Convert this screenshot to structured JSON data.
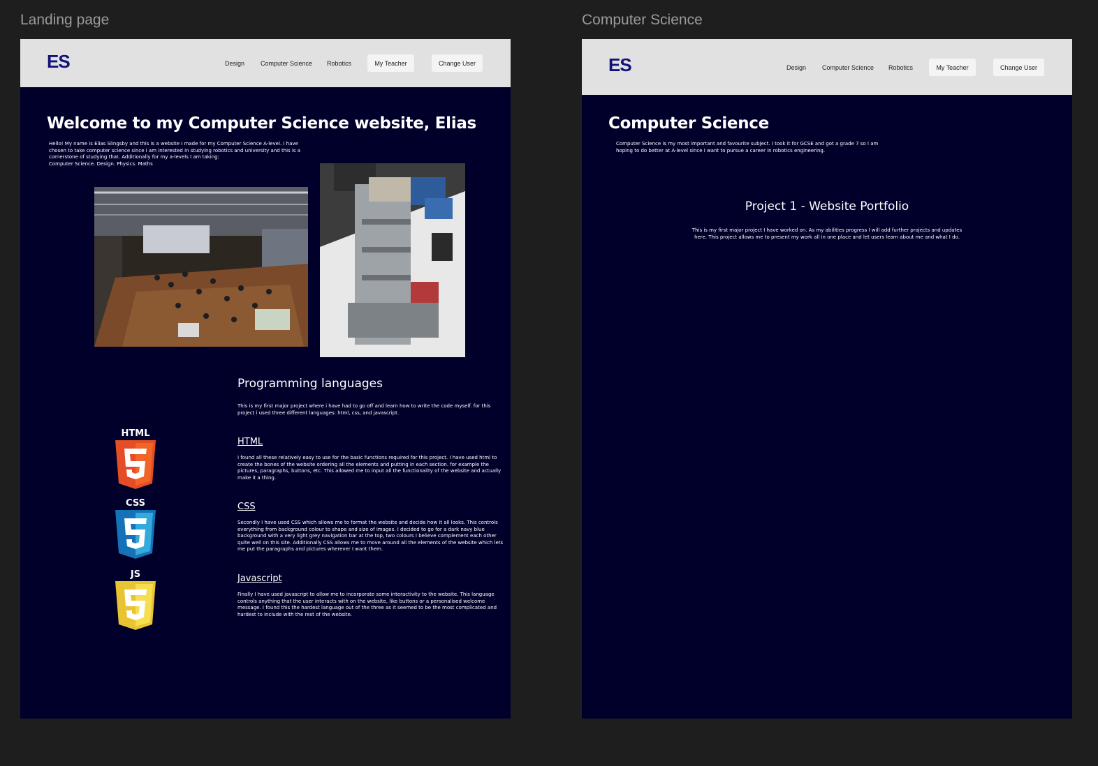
{
  "frames": {
    "landing": {
      "label": "Landing page",
      "nav": {
        "logo": "ES",
        "links": [
          "Design",
          "Computer Science",
          "Robotics"
        ],
        "teacher_button": "My Teacher",
        "user_button": "Change User"
      },
      "title": "Welcome to my Computer Science website, Elias",
      "intro": "Hello! My name is Elias Slingsby and this is a website I made for my Computer Science A-level. I have chosen to take computer science since i am interested in studying robotics and university and this is a cornerstone of studying that. Additionally for my a-levels I am taking:",
      "subjects": "Computer Science. Design.  Physics. Maths",
      "languages_heading": "Programming languages",
      "languages_intro": "This is my first major project where i have had to go off and learn how to write the code myself. for this project i used three different languages: html, css, and javascript.",
      "html": {
        "badge": "HTML",
        "heading": "HTML",
        "text": "I found all these relatively easy to use for the basic functions required for this project. I have used html to create the bones of the website ordering all the elements and putting in each section. for example the pictures, paragraphs, buttons, etc. This allowed me to input all the functionality of the website and actually make it a thing."
      },
      "css": {
        "badge": "CSS",
        "heading": "CSS",
        "text": "Secondly I have used CSS which allows me to format the website and decide how it all looks. This controls everything from background colour to shape and size of images. I decided to go for a dark navy blue background with a very light grey navigation bar at the top, two colours I believe complement each other quite well on this site. Additionally CSS allows me to move around all the elements of the website which lets me put the paragraphs and pictures wherever I want them."
      },
      "js": {
        "badge": "JS",
        "heading": "Javascript",
        "text": "Finally I have used javascript to allow me to incorporate some interactivity to the website. This language controls anything that the user interacts with on the website, like buttons or a personalised welcome message. I found this the hardest language out of the three as it seemed to be the most complicated and hardest to include with the rest of the website."
      }
    },
    "cs": {
      "label": "Computer Science",
      "nav": {
        "logo": "ES",
        "links": [
          "Design",
          "Computer Science",
          "Robotics"
        ],
        "teacher_button": "My Teacher",
        "user_button": "Change User"
      },
      "title": "Computer Science",
      "intro": "Computer Science is my most important and favourite subject. I took it for GCSE and got a grade 7 so I am hoping to do better at A-level since I want to pursue a career in robotics engineering.",
      "project_title": "Project 1 - Website Portfolio",
      "project_text": "This is my first major project I have worked on. As my abilities progress I will add further projects and updates here. This project allows me to present my work all in one place and let users learn about me and what I do."
    }
  },
  "colors": {
    "canvas": "#1e1e1e",
    "page_bg": "#00002b",
    "navbar": "#e1e1e1",
    "logo": "#12127a",
    "html_orange": "#e44d26",
    "css_blue": "#2965f1",
    "js_yellow": "#f0db4f"
  }
}
